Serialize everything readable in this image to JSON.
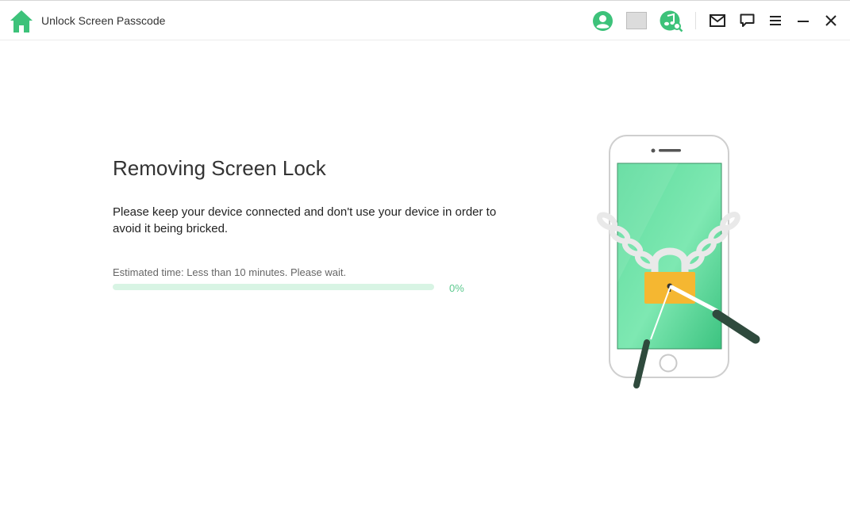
{
  "app": {
    "title": "Unlock Screen Passcode"
  },
  "toolbar": {
    "icons": [
      "home-icon",
      "user-account-icon",
      "grey-square-icon",
      "music-search-icon",
      "mail-icon",
      "chat-icon",
      "menu-icon",
      "minimize-icon",
      "close-icon"
    ]
  },
  "main": {
    "heading": "Removing Screen Lock",
    "description": "Please keep your device connected and don't use your device in order to avoid it being bricked.",
    "estimate": "Estimated time: Less than 10 minutes. Please wait.",
    "progress_percent": 0,
    "progress_label": "0%"
  },
  "colors": {
    "accent": "#3dc27a",
    "progress_track": "#d8f4e4",
    "progress_text": "#5cc98e",
    "lock": "#f5b731",
    "screen": "#4fd491"
  }
}
